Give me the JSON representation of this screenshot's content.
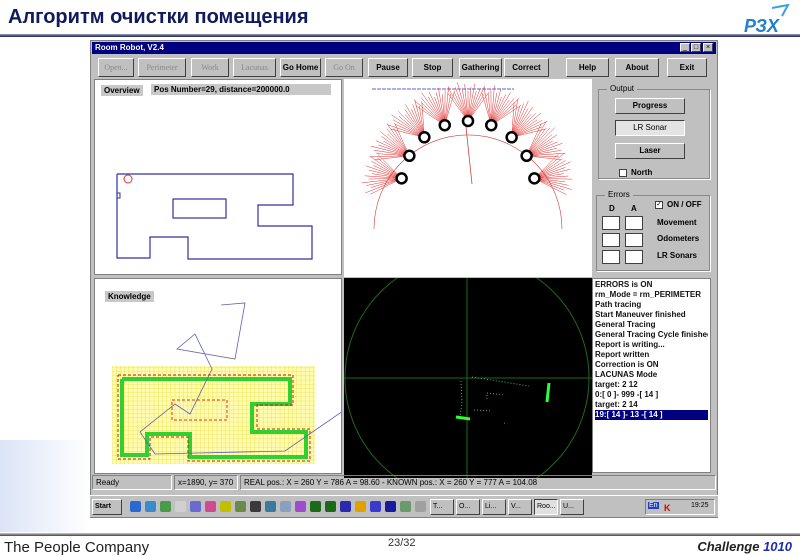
{
  "slide": {
    "title": "Алгоритм очистки помещения",
    "logo_text": "РЗХ",
    "footer_company": "The People Company",
    "page": "23/32",
    "challenge_word": "Challenge",
    "challenge_num": "1010"
  },
  "window": {
    "title": "Room Robot, V2.4",
    "controls": [
      "_",
      "□",
      "×"
    ]
  },
  "toolbar": [
    {
      "label": "Open...",
      "enabled": false
    },
    {
      "label": "Perimeter",
      "enabled": false
    },
    {
      "label": "Work",
      "enabled": false
    },
    {
      "label": "Lacunas",
      "enabled": false
    },
    {
      "label": "Go Home",
      "enabled": true
    },
    {
      "label": "Go On",
      "enabled": false
    },
    {
      "label": "Pause",
      "enabled": true
    },
    {
      "label": "Stop",
      "enabled": true
    },
    {
      "label": "Gathering",
      "enabled": true
    },
    {
      "label": "Correct",
      "enabled": true
    },
    {
      "label": "Help",
      "enabled": true
    },
    {
      "label": "About",
      "enabled": true
    },
    {
      "label": "Exit",
      "enabled": true
    }
  ],
  "overview": {
    "label": "Overview",
    "info": "Pos Number=29, distance=200000.0"
  },
  "knowledge": {
    "label": "Knowledge"
  },
  "output": {
    "title": "Output",
    "buttons": [
      "Progress",
      "LR Sonar",
      "Laser"
    ],
    "north_label": "North",
    "north_checked": false
  },
  "errors": {
    "title": "Errors",
    "col_d": "D",
    "col_a": "A",
    "onoff_label": "ON / OFF",
    "onoff_checked": true,
    "rows": [
      "Movement",
      "Odometers",
      "LR Sonars"
    ]
  },
  "log": [
    "ERRORS is ON",
    "rm_Mode = rm_PERIMETER",
    "Path tracing",
    "Start Maneuver finished",
    "General Tracing",
    "General Tracing Cycle finished",
    "Report is writing...",
    "Report written",
    "Correction is ON",
    "LACUNAS Mode",
    "target: 2  12",
    "0:[ 0 ]- 999 -[ 14 ]",
    "target: 2  14",
    "19:[ 14 ]- 13 -[ 14 ]"
  ],
  "status": {
    "state": "Ready",
    "coords": "x=1890, y= 370",
    "position": "REAL pos.: X = 260 Y = 786 A = 98.60 - KNOWN pos.: X = 260 Y = 777 A = 104.08"
  },
  "taskbar": {
    "start": "Start",
    "tasks": [
      "T...",
      "O...",
      "Li...",
      "V...",
      "Roo...",
      "U..."
    ],
    "tray_lang": "En",
    "clock": "19:25"
  }
}
